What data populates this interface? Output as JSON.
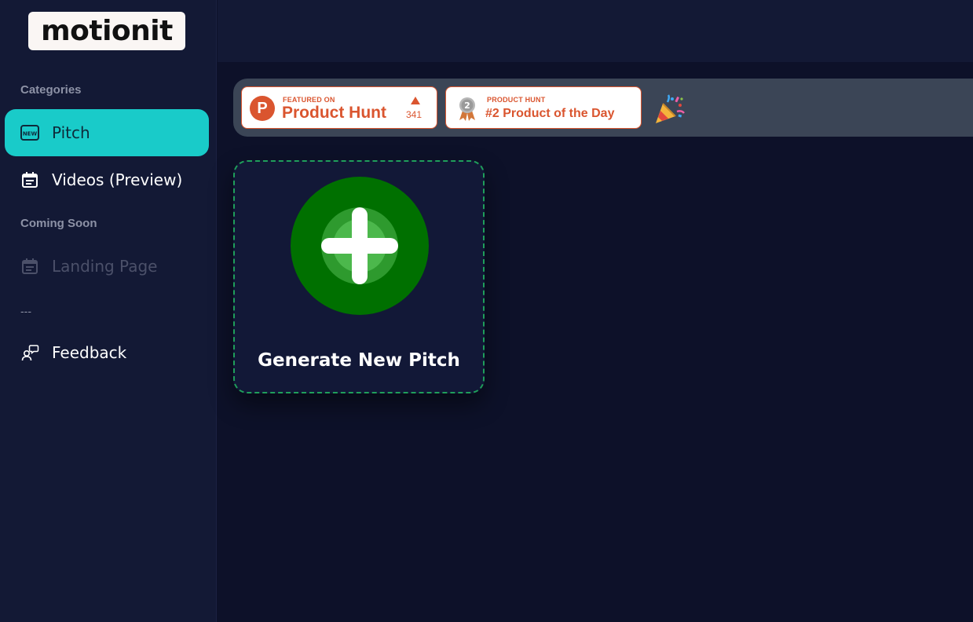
{
  "app": {
    "logo_text": "motionit"
  },
  "sidebar": {
    "categories_label": "Categories",
    "items": [
      {
        "label": "Pitch",
        "icon": "new-badge-icon",
        "active": true
      },
      {
        "label": "Videos (Preview)",
        "icon": "calendar-icon",
        "active": false
      }
    ],
    "coming_soon_label": "Coming Soon",
    "coming_soon_items": [
      {
        "label": "Landing Page",
        "icon": "calendar-icon",
        "disabled": true
      }
    ],
    "divider_text": "---",
    "feedback": {
      "label": "Feedback",
      "icon": "feedback-icon"
    }
  },
  "banner": {
    "product_hunt_badge": {
      "small": "FEATURED ON",
      "big": "Product Hunt",
      "votes": "341",
      "logo_letter": "P"
    },
    "product_of_day_badge": {
      "small": "PRODUCT HUNT",
      "big": "#2 Product of the Day",
      "medal_number": "2"
    },
    "celebration_icon": "party-popper-icon"
  },
  "main": {
    "card": {
      "title": "Generate New Pitch",
      "icon": "plus-icon"
    }
  },
  "colors": {
    "background": "#0d1129",
    "sidebar": "#131935",
    "accent": "#19cbc9",
    "product_hunt": "#da552f",
    "card_border": "#1f9e5b",
    "plus_green": "#007000"
  }
}
